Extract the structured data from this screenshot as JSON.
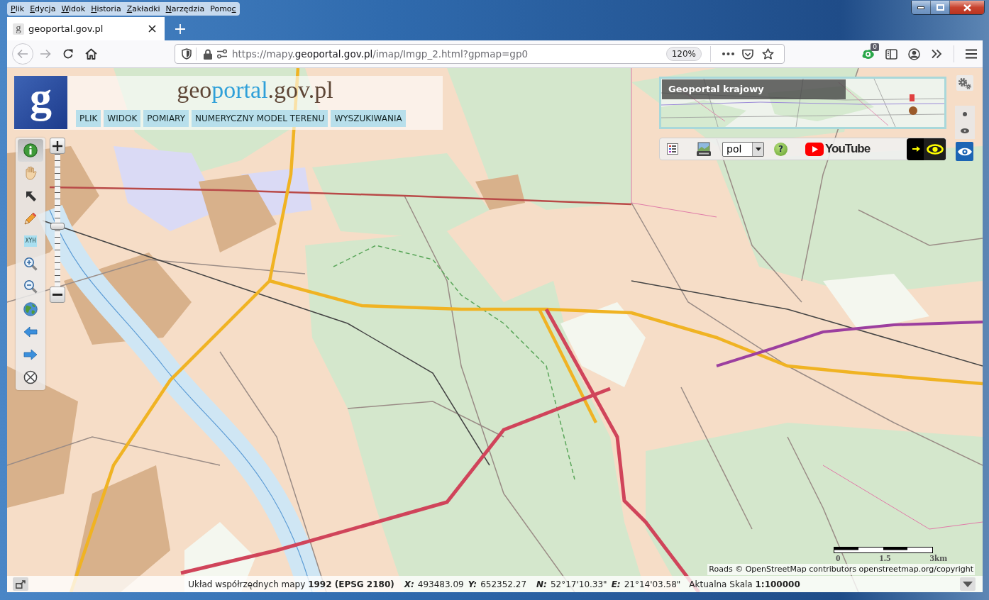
{
  "menu_bar": [
    {
      "key": "P",
      "tail": "lik"
    },
    {
      "key": "E",
      "tail": "dycja"
    },
    {
      "key": "W",
      "tail": "idok"
    },
    {
      "key": "H",
      "tail": "istoria"
    },
    {
      "key": "Z",
      "tail": "akładki"
    },
    {
      "key": "N",
      "tail": "arzędzia"
    },
    {
      "head": "Pomo",
      "key": "c"
    }
  ],
  "tabs": [
    {
      "favicon": "g",
      "title": "geoportal.gov.pl",
      "selected": true
    }
  ],
  "nav_buttons": [
    {
      "kind": "back",
      "disabled": true
    },
    {
      "kind": "forward",
      "disabled": true
    },
    {
      "kind": "reload",
      "disabled": false
    },
    {
      "kind": "home",
      "disabled": false
    }
  ],
  "address_bar": {
    "url": {
      "prefix": "https://mapy.",
      "domain": "geoportal.gov.pl",
      "suffix": "/imap/Imgp_2.html?gpmap=gp0"
    },
    "zoom": "120%"
  },
  "toolbar": {
    "extension_badge": "0"
  },
  "geoportal": {
    "logo": "g",
    "title": {
      "head": "geo",
      "accent": "portal",
      "tail": ".gov.pl"
    },
    "menu": [
      "PLIK",
      "WIDOK",
      "POMIARY",
      "NUMERYCZNY MODEL TERENU",
      "WYSZUKIWANIA"
    ]
  },
  "tools": [
    {
      "kind": "info",
      "selected": true
    },
    {
      "kind": "pan",
      "selected": false
    },
    {
      "kind": "select",
      "selected": false
    },
    {
      "kind": "draw",
      "selected": false
    },
    {
      "kind": "coordinates",
      "label": "XYH",
      "selected": false
    },
    {
      "kind": "zoom-in",
      "selected": false
    },
    {
      "kind": "zoom-out",
      "selected": false
    },
    {
      "kind": "extent",
      "selected": false
    },
    {
      "kind": "previous",
      "selected": false
    },
    {
      "kind": "next",
      "selected": false
    },
    {
      "kind": "clear",
      "selected": false
    }
  ],
  "zoom_slider": {
    "level": 0.45
  },
  "overview_map": {
    "title": "Geoportal krajowy"
  },
  "map_toolbar": {
    "language": "pol",
    "help": "?",
    "youtube": "YouTube"
  },
  "scale_bar": {
    "labels": [
      "0",
      "1.5",
      "3km"
    ]
  },
  "attribution": "Roads © OpenStreetMap contributors openstreetmap.org/copyright",
  "status_bar": {
    "crs": "Układ współrzędnych mapy **1992 (EPSG 2180)**",
    "coordinate_groups": [
      [
        {
          "label": "X:",
          "value": "493483.09"
        },
        {
          "label": "Y:",
          "value": "652352.27"
        }
      ],
      [
        {
          "label": "N:",
          "value": "52°17'10.33\""
        },
        {
          "label": "E:",
          "value": "21°14'03.58\""
        }
      ]
    ],
    "scale": "Aktualna Skala **1:100000**"
  }
}
